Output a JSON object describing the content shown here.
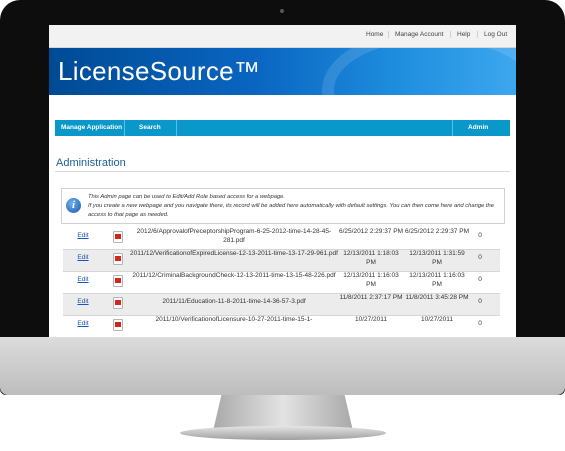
{
  "topnav": {
    "home": "Home",
    "manage_account": "Manage Account",
    "help": "Help",
    "logout": "Log Out"
  },
  "banner": {
    "title": "LicenseSource™"
  },
  "mainnav": {
    "manage_application": "Manage Application",
    "search": "Search",
    "admin": "Admin"
  },
  "page": {
    "heading": "Administration"
  },
  "info": {
    "line1": "This Admin page can be used to Edit/Add Role based access for a webpage.",
    "line2": "If you create a new webpage and you navigate there, its record will be added here automatically with default settings. You can then come here and change the access to that page as needed."
  },
  "table": {
    "rows": [
      {
        "edit": "Edit",
        "file": "2012/6/ApprovalofPreceptorshipProgram-6-25-2012-time-14-28-45-281.pdf",
        "created": "6/25/2012 2:29:37 PM",
        "modified": "6/25/2012 2:29:37 PM",
        "count": "0"
      },
      {
        "edit": "Edit",
        "file": "2011/12/VerificationofExpiredLicense-12-13-2011-time-13-17-29-961.pdf",
        "created": "12/13/2011 1:18:03 PM",
        "modified": "12/13/2011 1:31:59 PM",
        "count": "0"
      },
      {
        "edit": "Edit",
        "file": "2011/12/CriminalBackgroundCheck-12-13-2011-time-13-15-48-226.pdf",
        "created": "12/13/2011 1:16:03 PM",
        "modified": "12/13/2011 1:16:03 PM",
        "count": "0"
      },
      {
        "edit": "Edit",
        "file": "2011/11/Education-11-8-2011-time-14-36-57-3.pdf",
        "created": "11/8/2011 2:37:17 PM",
        "modified": "11/8/2011 3:45:28 PM",
        "count": "0"
      },
      {
        "edit": "Edit",
        "file": "2011/10/VerificationofLicensure-10-27-2011-time-15-1-",
        "created": "10/27/2011",
        "modified": "10/27/2011",
        "count": "0"
      }
    ]
  }
}
